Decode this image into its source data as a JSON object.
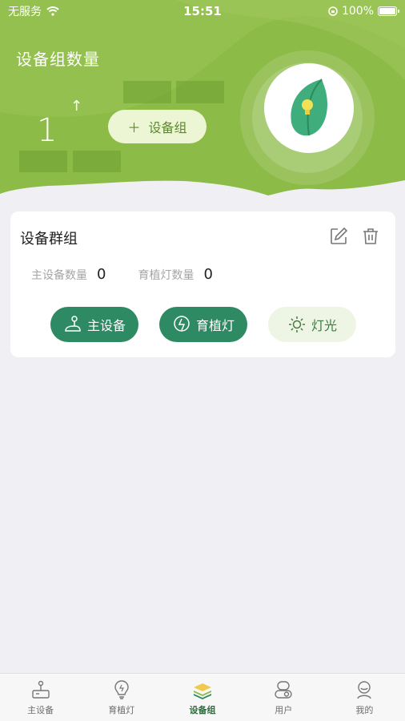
{
  "status_bar": {
    "carrier": "无服务",
    "time": "15:51",
    "battery": "100%"
  },
  "header": {
    "title": "设备组数量",
    "count": "1",
    "unit": "个",
    "add_button": "设备组"
  },
  "card": {
    "title": "设备群组",
    "stats": [
      {
        "label": "主设备数量",
        "value": "0"
      },
      {
        "label": "育植灯数量",
        "value": "0"
      }
    ],
    "buttons": [
      {
        "label": "主设备",
        "icon": "joystick-icon"
      },
      {
        "label": "育植灯",
        "icon": "bulb-icon"
      },
      {
        "label": "灯光",
        "icon": "sun-icon"
      }
    ]
  },
  "tabbar": {
    "items": [
      {
        "label": "主设备",
        "icon": "joystick-icon"
      },
      {
        "label": "育植灯",
        "icon": "bulb-icon"
      },
      {
        "label": "设备组",
        "icon": "layers-icon",
        "active": true
      },
      {
        "label": "用户",
        "icon": "user-toggle-icon"
      },
      {
        "label": "我的",
        "icon": "profile-icon"
      }
    ]
  },
  "colors": {
    "header_green": "#8dbb48",
    "accent_dark": "#2e8a62",
    "tab_active": "#2f6a3c"
  }
}
